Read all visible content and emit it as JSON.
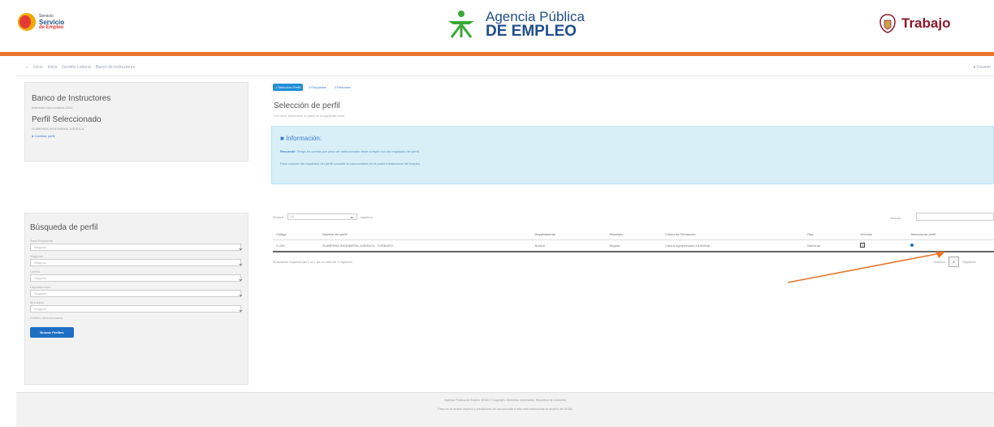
{
  "header": {
    "left_logo": {
      "line1": "Servicio",
      "line2": "Servicio",
      "line3": "de Empleo"
    },
    "center_logo": {
      "line1": "Agencia Pública",
      "line2": "DE EMPLEO"
    },
    "right_logo": {
      "text": "Trabajo"
    }
  },
  "breadcrumb": {
    "items": [
      "Inicio",
      "Inicio",
      "Gestión Laboral",
      "Banco de instructores"
    ],
    "user": "Usuario"
  },
  "profile_panel": {
    "title": "Banco de Instructores",
    "subtitle": "Instructor convocatoria 2024",
    "selected_title": "Perfil Seleccionado",
    "selected_subtitle": "GUBERNIA INGENIERIA JURIDICA",
    "change_link": "Cambiar perfil"
  },
  "search_panel": {
    "title": "Búsqueda de perfil",
    "filters": [
      {
        "label": "Área Requerida",
        "value": "Ninguno"
      },
      {
        "label": "Regional",
        "value": "Ninguno"
      },
      {
        "label": "Centro",
        "value": "Ninguno"
      },
      {
        "label": "Departamento",
        "value": "Ninguno"
      },
      {
        "label": "Municipio",
        "value": "Ninguno"
      }
    ],
    "extra_label": "Perfiles Seleccionados",
    "button": "Buscar Perfiles"
  },
  "tabs": [
    {
      "label": "1 Selección Perfil",
      "active": true
    },
    {
      "label": "2 Requisitos",
      "active": false
    },
    {
      "label": "3 Resumen",
      "active": false
    }
  ],
  "section": {
    "title": "Selección de perfil",
    "subtitle": "Por favor seleccione el perfil de la siguiente tabla"
  },
  "info": {
    "title": "Información:",
    "line1_bold": "Recuerde:",
    "line1": "Tenga en cuenta que para ser seleccionado debe cumplir con los requisitos del perfil.",
    "line2": "Para conocer los requisitos del perfil consulte la convocatoria en el portal institucional del empleo."
  },
  "table_controls": {
    "show_label": "Mostrar",
    "length_value": "10",
    "records_label": "registros",
    "search_label": "Buscar:"
  },
  "table": {
    "headers": [
      "Código",
      "Nombre del perfil",
      "Departamento",
      "Municipio",
      "Centro de Formación",
      "Red",
      "Ver más",
      "Seleccionar perfil"
    ],
    "rows": [
      [
        "C-001",
        "GUBERNIA INGENIERIA JURIDICA - TURBARO",
        "Bolívar",
        "Bogotá",
        "Centro Agropecuario La Bolivar",
        "Nacional",
        "",
        ""
      ]
    ]
  },
  "pagination": {
    "info": "Mostrando registros del 1 al 1 de un total de 1 registros",
    "prev": "Anterior",
    "page": "1",
    "next": "Siguiente"
  },
  "footer": {
    "line1": "Agencia Pública de Empleo SENA © Copyright. Derechos reservados. República de Colombia",
    "line2": "Para ver la versión impresa y condiciones de uso consulte el sitio web institucional de empleo del SENA"
  },
  "colors": {
    "accent_orange": "#e8752a",
    "brand_blue": "#1f6fc4",
    "info_bg": "#d9eff8"
  }
}
